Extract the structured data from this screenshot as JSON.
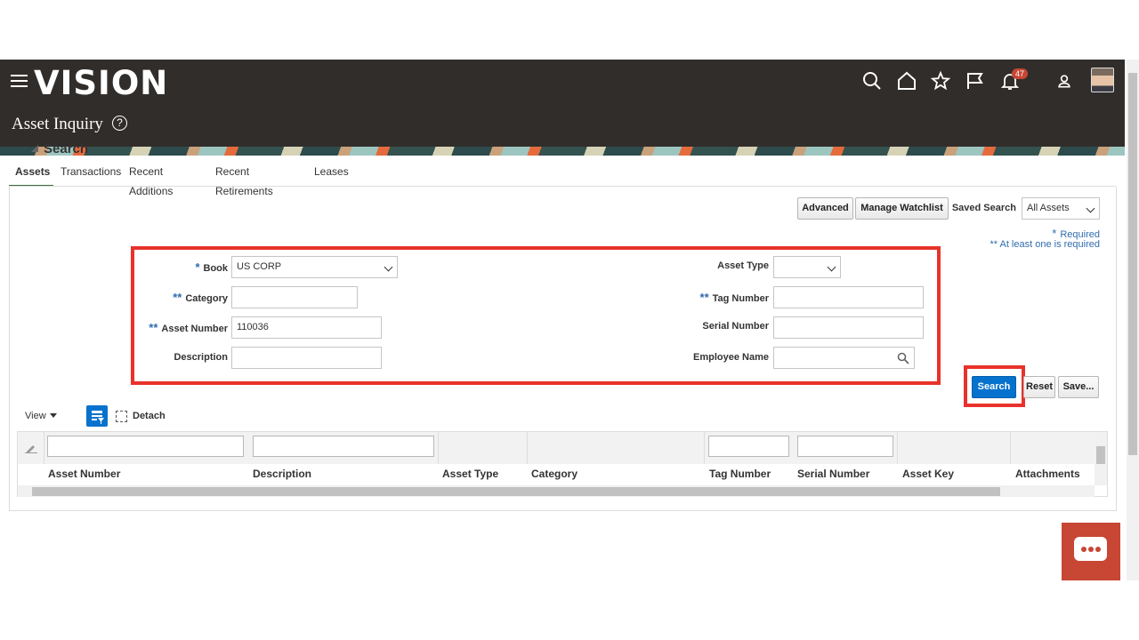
{
  "header": {
    "logo": "VISION",
    "page_title": "Asset Inquiry",
    "help_glyph": "?",
    "notification_count": "47",
    "icons": [
      "search-icon",
      "home-icon",
      "star-icon",
      "flag-icon",
      "bell-icon",
      "user-icon",
      "avatar"
    ]
  },
  "tabs": [
    {
      "label": "Assets",
      "active": true
    },
    {
      "label": "Transactions"
    },
    {
      "label": "Recent Additions"
    },
    {
      "label": "Recent Retirements"
    },
    {
      "label": "Leases"
    }
  ],
  "search": {
    "title": "Search",
    "advanced_label": "Advanced",
    "manage_watchlist_label": "Manage Watchlist",
    "saved_search_label": "Saved Search",
    "saved_search_value": "All Assets",
    "required_note": "Required",
    "required_star": "*",
    "at_least_one_note": "** At least one is required",
    "fields": {
      "book": {
        "label": "Book",
        "marker": "*",
        "value": "US CORP"
      },
      "category": {
        "label": "Category",
        "marker": "**",
        "value": ""
      },
      "asset_number": {
        "label": "Asset Number",
        "marker": "**",
        "value": "110036"
      },
      "description": {
        "label": "Description",
        "value": ""
      },
      "asset_type": {
        "label": "Asset Type",
        "value": ""
      },
      "tag_number": {
        "label": "Tag Number",
        "marker": "**",
        "value": ""
      },
      "serial_number": {
        "label": "Serial Number",
        "value": ""
      },
      "employee_name": {
        "label": "Employee Name",
        "value": ""
      }
    },
    "search_label": "Search",
    "reset_label": "Reset",
    "save_label": "Save..."
  },
  "toolbar": {
    "view_label": "View",
    "detach_label": "Detach"
  },
  "table": {
    "columns": [
      "Asset Number",
      "Description",
      "Asset Type",
      "Category",
      "Tag Number",
      "Serial Number",
      "Asset Key",
      "Attachments"
    ]
  },
  "colors": {
    "header_bg": "#312d2a",
    "primary_button": "#0572ce",
    "highlight": "#e8322b",
    "chat": "#c74634"
  }
}
